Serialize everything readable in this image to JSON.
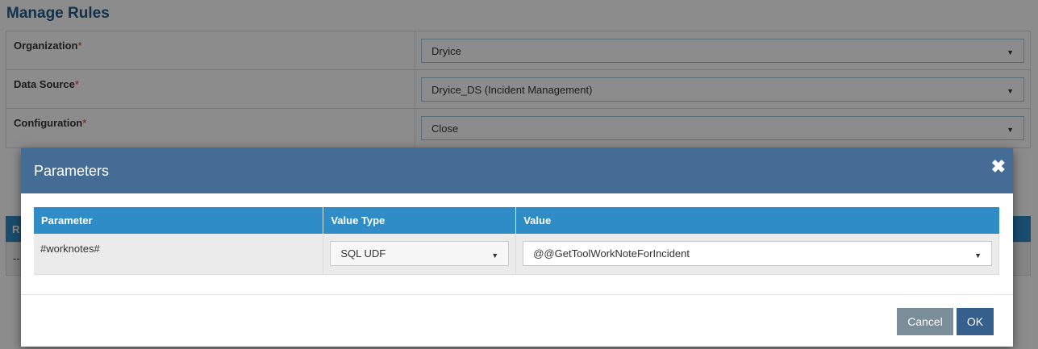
{
  "page": {
    "title": "Manage Rules",
    "fields": [
      {
        "label": "Organization",
        "required": "*",
        "value": "Dryice"
      },
      {
        "label": "Data Source",
        "required": "*",
        "value": "Dryice_DS (Incident Management)"
      },
      {
        "label": "Configuration",
        "required": "*",
        "value": "Close"
      }
    ],
    "bg_table_header": "R",
    "bg_table_cell": "--"
  },
  "modal": {
    "title": "Parameters",
    "close_icon": "close-icon",
    "columns": [
      "Parameter",
      "Value Type",
      "Value"
    ],
    "rows": [
      {
        "parameter": "#worknotes#",
        "value_type": "SQL UDF",
        "value": "@@GetToolWorkNoteForIncident"
      }
    ],
    "cancel_label": "Cancel",
    "ok_label": "OK"
  },
  "colors": {
    "header_bg": "#456c94",
    "table_header_bg": "#2f8cc6",
    "title_color": "#1f5a8a",
    "cancel_bg": "#7b8d99",
    "ok_bg": "#375f8c"
  }
}
